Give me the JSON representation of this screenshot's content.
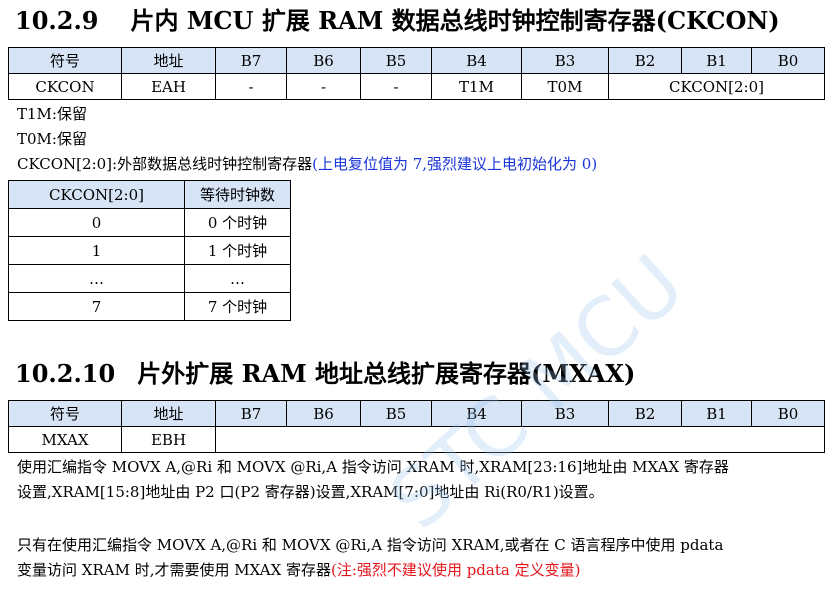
{
  "section1": {
    "number": "10.2.9",
    "title": "片内 MCU 扩展 RAM 数据总线时钟控制寄存器(CKCON)",
    "register_table": {
      "headers": [
        "符号",
        "地址",
        "B7",
        "B6",
        "B5",
        "B4",
        "B3",
        "B2",
        "B1",
        "B0"
      ],
      "row": {
        "symbol": "CKCON",
        "address": "EAH",
        "b7": "-",
        "b6": "-",
        "b5": "-",
        "b4": "T1M",
        "b3": "T0M",
        "b2_b0": "CKCON[2:0]"
      }
    },
    "t1m": "T1M:保留",
    "t0m": "T0M:保留",
    "ckcon_desc": "CKCON[2:0]:外部数据总线时钟控制寄存器",
    "ckcon_note": "(上电复位值为 7,强烈建议上电初始化为 0)",
    "wait_table": {
      "headers": [
        "CKCON[2:0]",
        "等待时钟数"
      ],
      "rows": [
        [
          "0",
          "0 个时钟"
        ],
        [
          "1",
          "1 个时钟"
        ],
        [
          "…",
          "…"
        ],
        [
          "7",
          "7 个时钟"
        ]
      ]
    }
  },
  "section2": {
    "number": "10.2.10",
    "title": "片外扩展 RAM 地址总线扩展寄存器(MXAX)",
    "register_table": {
      "headers": [
        "符号",
        "地址",
        "B7",
        "B6",
        "B5",
        "B4",
        "B3",
        "B2",
        "B1",
        "B0"
      ],
      "row": {
        "symbol": "MXAX",
        "address": "EBH",
        "bits": ""
      }
    },
    "para1_line1": "使用汇编指令 MOVX A,@Ri 和 MOVX @Ri,A 指令访问 XRAM 时,XRAM[23:16]地址由 MXAX 寄存器",
    "para1_line2": "设置,XRAM[15:8]地址由 P2 口(P2 寄存器)设置,XRAM[7:0]地址由 Ri(R0/R1)设置。",
    "para2_line1": "只有在使用汇编指令 MOVX A,@Ri 和 MOVX @Ri,A 指令访问 XRAM,或者在 C 语言程序中使用 pdata",
    "para2_line2": "变量访问 XRAM 时,才需要使用 MXAX 寄存器",
    "para2_note": "(注:强烈不建议使用 pdata 定义变量)"
  },
  "watermark": "STC MCU",
  "colors": {
    "header_fill": "#d6e4f6",
    "note_blue": "#1a35d8",
    "note_red": "#e4141b"
  }
}
